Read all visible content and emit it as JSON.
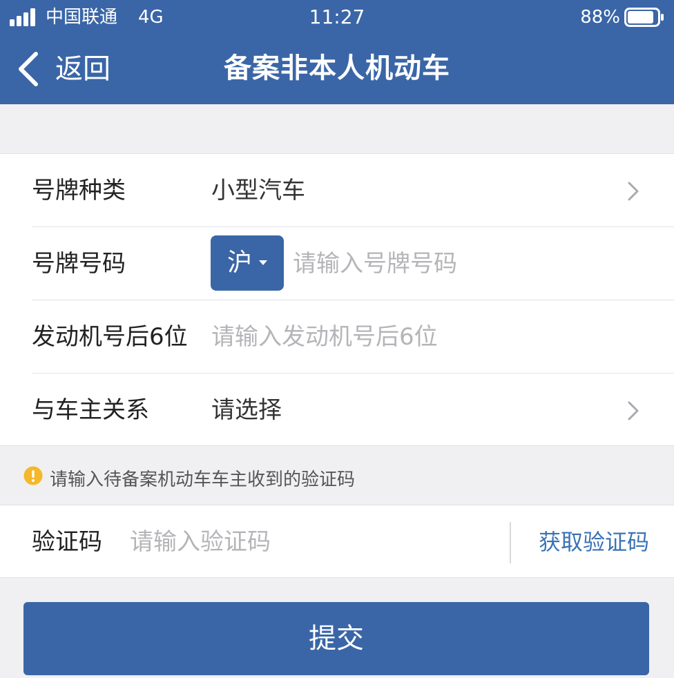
{
  "status_bar": {
    "carrier": "中国联通",
    "network": "4G",
    "time": "11:27",
    "battery_percent": "88%",
    "battery_level": 0.88,
    "signal_icon": "signal-bars-icon",
    "battery_icon": "battery-icon"
  },
  "nav": {
    "back_label": "返回",
    "back_icon": "chevron-left-icon",
    "title": "备案非本人机动车"
  },
  "form": {
    "plate_type": {
      "label": "号牌种类",
      "value": "小型汽车",
      "icon": "chevron-right-icon"
    },
    "plate_number": {
      "label": "号牌号码",
      "province": "沪",
      "province_icon": "caret-down-icon",
      "value": "",
      "placeholder": "请输入号牌号码"
    },
    "engine_number": {
      "label": "发动机号后6位",
      "value": "",
      "placeholder": "请输入发动机号后6位"
    },
    "relationship": {
      "label": "与车主关系",
      "value": "请选择",
      "icon": "chevron-right-icon"
    }
  },
  "hint": {
    "icon": "warning-circle-icon",
    "text": "请输入待备案机动车车主收到的验证码"
  },
  "verification": {
    "label": "验证码",
    "value": "",
    "placeholder": "请输入验证码",
    "get_code_label": "获取验证码"
  },
  "submit_label": "提交",
  "colors": {
    "primary": "#3a66a7",
    "link": "#3a73b4",
    "warning": "#f5b82a",
    "background": "#f0f0f2"
  }
}
